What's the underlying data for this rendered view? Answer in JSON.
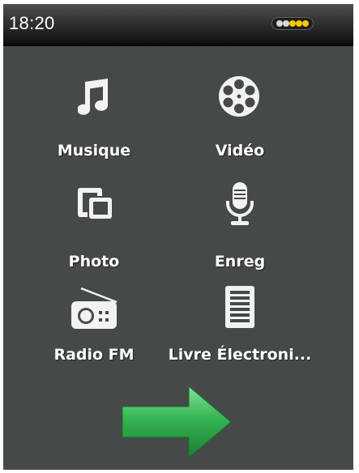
{
  "status": {
    "time": "18:20",
    "battery_level": "3/5"
  },
  "menu": {
    "items": [
      {
        "label": "Musique",
        "icon": "music-note-icon"
      },
      {
        "label": "Vidéo",
        "icon": "film-reel-icon"
      },
      {
        "label": "Photo",
        "icon": "photo-frames-icon"
      },
      {
        "label": "Enreg",
        "icon": "microphone-icon"
      },
      {
        "label": "Radio FM",
        "icon": "radio-icon"
      },
      {
        "label": "Livre Électroni...",
        "icon": "ebook-document-icon"
      }
    ]
  },
  "navigation": {
    "next_icon": "green-arrow-right-icon"
  },
  "colors": {
    "background": "#454a49",
    "battery_on": "#f5c800",
    "battery_off": "#d8d8d8",
    "arrow": "#2fb54e"
  }
}
